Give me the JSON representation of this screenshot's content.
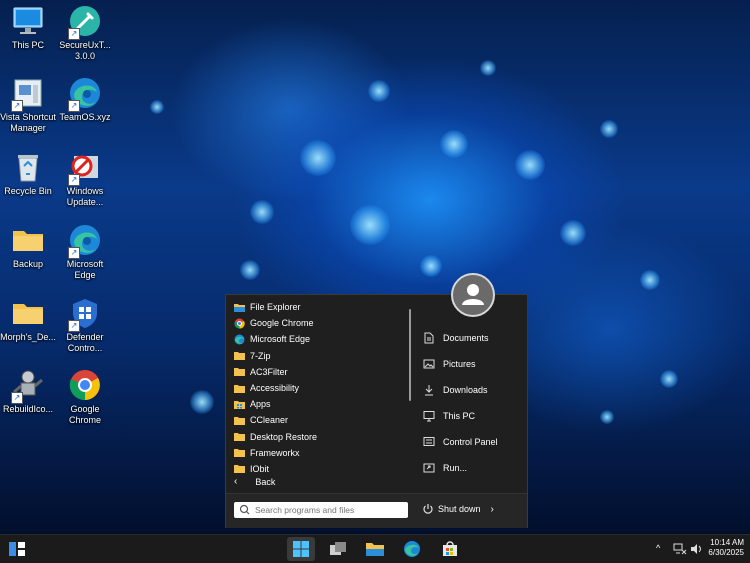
{
  "desktop": {
    "icons": [
      {
        "label": "This PC",
        "icon": "monitor-icon"
      },
      {
        "label": "SecureUxT...\n3.0.0",
        "icon": "teal-wrench-icon"
      },
      {
        "label": "Vista Shortcut\nManager",
        "icon": "shortcut-manager-icon"
      },
      {
        "label": "TeamOS.xyz",
        "icon": "edge-icon"
      },
      {
        "label": "Recycle Bin",
        "icon": "recycle-bin-icon"
      },
      {
        "label": "Windows\nUpdate...",
        "icon": "windows-update-blocker-icon"
      },
      {
        "label": "Backup",
        "icon": "folder-icon"
      },
      {
        "label": "Microsoft\nEdge",
        "icon": "edge-icon"
      },
      {
        "label": "Morph's_De...",
        "icon": "folder-icon"
      },
      {
        "label": "Defender\nContro...",
        "icon": "defender-shield-icon"
      },
      {
        "label": "RebuildIco...",
        "icon": "robot-icon"
      },
      {
        "label": "Google\nChrome",
        "icon": "chrome-icon"
      }
    ]
  },
  "start_menu": {
    "programs": [
      {
        "label": "File Explorer",
        "icon": "file-explorer-icon"
      },
      {
        "label": "Google Chrome",
        "icon": "chrome-icon"
      },
      {
        "label": "Microsoft Edge",
        "icon": "edge-icon"
      },
      {
        "label": "7-Zip",
        "icon": "folder-icon"
      },
      {
        "label": "AC3Filter",
        "icon": "folder-icon"
      },
      {
        "label": "Accessibility",
        "icon": "folder-icon"
      },
      {
        "label": "Apps",
        "icon": "apps-icon"
      },
      {
        "label": "CCleaner",
        "icon": "folder-icon"
      },
      {
        "label": "Desktop Restore",
        "icon": "folder-icon"
      },
      {
        "label": "Frameworkx",
        "icon": "folder-icon"
      },
      {
        "label": "IObit",
        "icon": "folder-icon"
      }
    ],
    "right_items": [
      {
        "label": "Documents",
        "icon": "document-icon"
      },
      {
        "label": "Pictures",
        "icon": "picture-icon"
      },
      {
        "label": "Downloads",
        "icon": "download-icon"
      },
      {
        "label": "This PC",
        "icon": "computer-icon"
      },
      {
        "label": "Control Panel",
        "icon": "control-panel-icon"
      },
      {
        "label": "Run...",
        "icon": "run-icon"
      }
    ],
    "back_label": "Back",
    "search_placeholder": "Search programs and files",
    "shutdown_label": "Shut down"
  },
  "taskbar": {
    "time": "10:14 AM",
    "date": "6/30/2025"
  },
  "colors": {
    "folder": "#f2c14e",
    "accent": "#3a8ee6",
    "menu_bg": "#1f1f1f"
  }
}
